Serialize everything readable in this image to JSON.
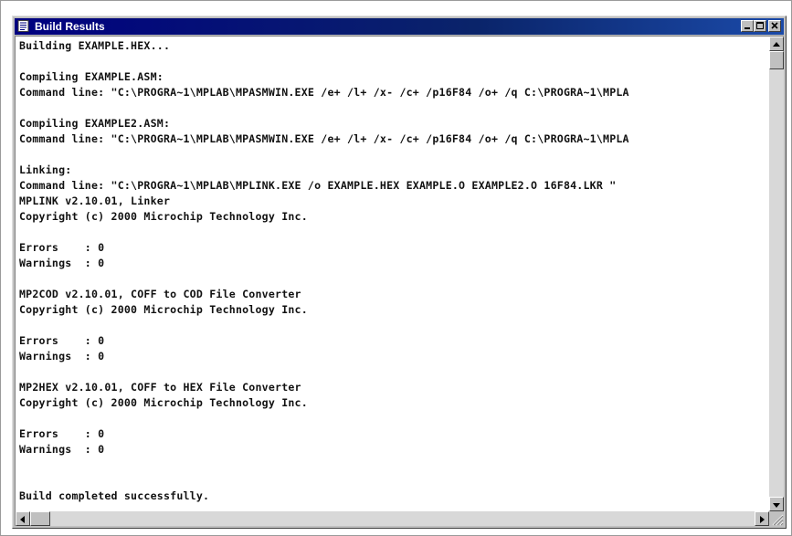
{
  "window": {
    "title": "Build Results",
    "icon": "document-icon",
    "controls": [
      "minimize-icon",
      "maximize-icon",
      "close-icon"
    ]
  },
  "log": {
    "lines": [
      "Building EXAMPLE.HEX...",
      "",
      "Compiling EXAMPLE.ASM:",
      "Command line: \"C:\\PROGRA~1\\MPLAB\\MPASMWIN.EXE /e+ /l+ /x- /c+ /p16F84 /o+ /q C:\\PROGRA~1\\MPLA",
      "",
      "Compiling EXAMPLE2.ASM:",
      "Command line: \"C:\\PROGRA~1\\MPLAB\\MPASMWIN.EXE /e+ /l+ /x- /c+ /p16F84 /o+ /q C:\\PROGRA~1\\MPLA",
      "",
      "Linking:",
      "Command line: \"C:\\PROGRA~1\\MPLAB\\MPLINK.EXE /o EXAMPLE.HEX EXAMPLE.O EXAMPLE2.O 16F84.LKR \"",
      "MPLINK v2.10.01, Linker",
      "Copyright (c) 2000 Microchip Technology Inc.",
      "",
      "Errors    : 0",
      "Warnings  : 0",
      "",
      "MP2COD v2.10.01, COFF to COD File Converter",
      "Copyright (c) 2000 Microchip Technology Inc.",
      "",
      "Errors    : 0",
      "Warnings  : 0",
      "",
      "MP2HEX v2.10.01, COFF to HEX File Converter",
      "Copyright (c) 2000 Microchip Technology Inc.",
      "",
      "Errors    : 0",
      "Warnings  : 0",
      "",
      "",
      "Build completed successfully."
    ]
  },
  "colors": {
    "titlebar": "#000080",
    "text": "#111111",
    "chrome": "#c0c0c0"
  }
}
